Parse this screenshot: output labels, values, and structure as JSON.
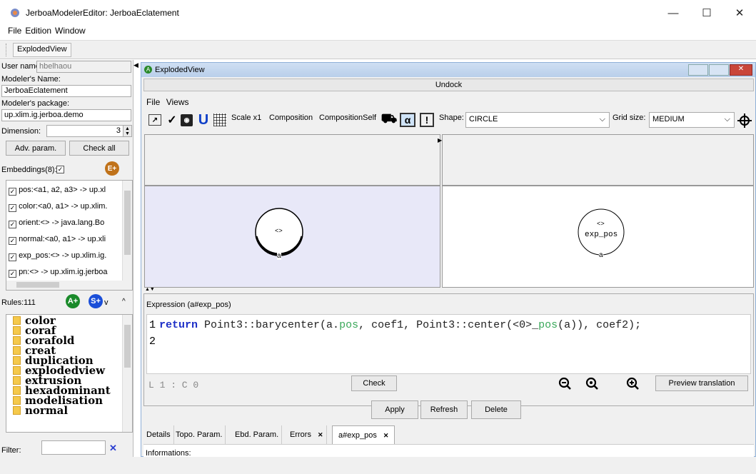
{
  "window": {
    "title": "JerboaModelerEditor: JerboaEclatement",
    "minimize": "—",
    "maximize": "☐",
    "close": "✕"
  },
  "menu": [
    "File",
    "Edition",
    "Window"
  ],
  "tabs": {
    "exploded": "ExplodedView"
  },
  "left": {
    "user_label": "User name",
    "user_value": "hbelhaou",
    "modeler_name_label": "Modeler's Name:",
    "modeler_name_value": "JerboaEclatement",
    "package_label": "Modeler's package:",
    "package_value": "up.xlim.ig.jerboa.demo",
    "dimension_label": "Dimension:",
    "dimension_value": "3",
    "adv_param": "Adv. param.",
    "check_all": "Check all",
    "embeddings_label": "Embeddings(8):",
    "e_plus": "E+",
    "embeddings": [
      "pos:<a1, a2, a3> -> up.xl",
      "color:<a0, a1> -> up.xlim.",
      "orient:<> -> java.lang.Bo",
      "normal:<a0, a1> -> up.xli",
      "exp_pos:<> -> up.xlim.ig.",
      "pn:<> -> up.xlim.ig.jerboa"
    ],
    "rules_label": "Rules:111",
    "a_plus": "A+",
    "s_plus": "S+",
    "rules_v": "v",
    "rules": [
      "color",
      "coraf",
      "corafold",
      "creat",
      "duplication",
      "explodedview",
      "extrusion",
      "hexadominant",
      "modelisation",
      "normal"
    ],
    "filter_label": "Filter:",
    "filter_value": "",
    "filter_clear": "✕"
  },
  "inner": {
    "title": "ExplodedView",
    "undock": "Undock",
    "menu": [
      "File",
      "Views"
    ],
    "scale": "Scale x1",
    "composition": "Composition",
    "composition_self": "CompositionSelf",
    "alpha": "α",
    "excl": "!",
    "shape_label": "Shape:",
    "shape_value": "CIRCLE",
    "grid_label": "Grid size:",
    "grid_value": "MEDIUM",
    "left_node_label": "<>",
    "left_node_edge": "a",
    "right_node_label": "<>",
    "right_node_name": "exp_pos",
    "right_node_edge": "a"
  },
  "expression": {
    "label": "Expression (a#exp_pos)",
    "line1_no": "1",
    "line2_no": "2",
    "code_kw": "return",
    "code_a": " Point3::barycenter(a.",
    "code_pos": "pos",
    "code_b": ", coef1, Point3::center(<0>_",
    "code_pos2": "pos",
    "code_c": "(a)), coef2);",
    "cursor": "L 1 : C 0",
    "check": "Check",
    "preview": "Preview translation"
  },
  "actions": {
    "apply": "Apply",
    "refresh": "Refresh",
    "delete": "Delete"
  },
  "bottom_tabs": [
    "Details",
    "Topo. Param.",
    "Ebd. Param.",
    "Errors",
    "a#exp_pos"
  ],
  "tab_close": "✕",
  "info_label": "Informations:"
}
